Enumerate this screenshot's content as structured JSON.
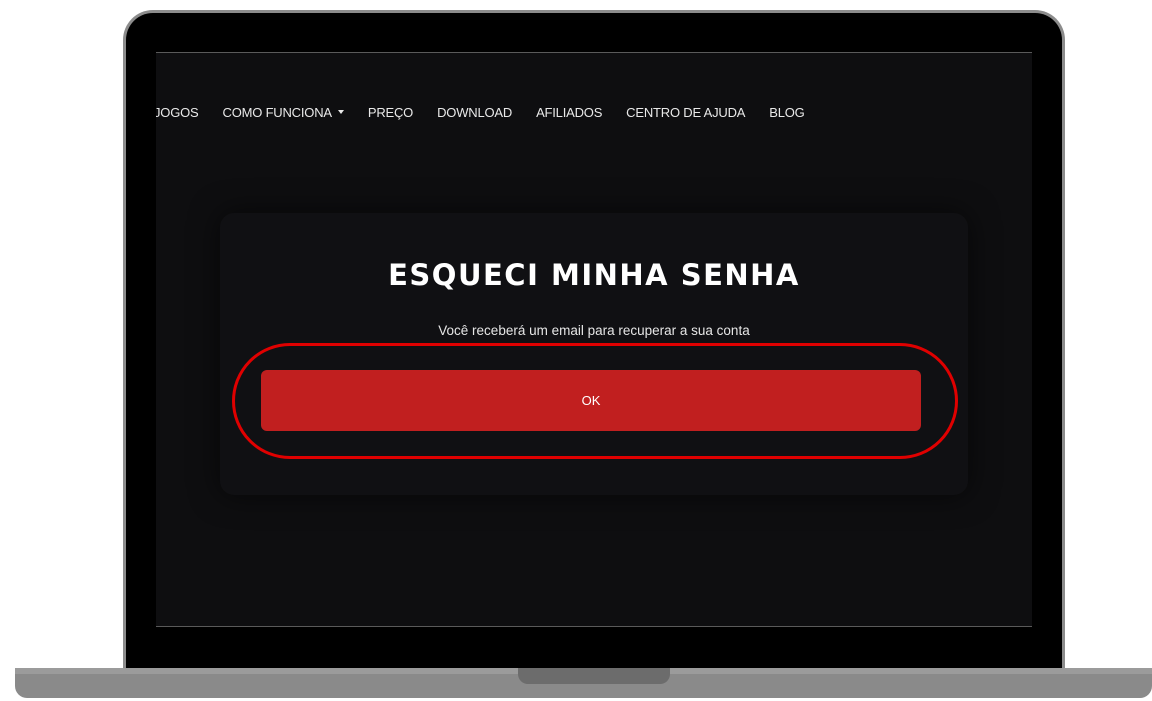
{
  "nav": {
    "items": [
      {
        "label": "JOGOS"
      },
      {
        "label": "COMO FUNCIONA",
        "has_dropdown": true
      },
      {
        "label": "PREÇO"
      },
      {
        "label": "DOWNLOAD"
      },
      {
        "label": "AFILIADOS"
      },
      {
        "label": "CENTRO DE AJUDA"
      },
      {
        "label": "BLOG"
      }
    ]
  },
  "dialog": {
    "title": "ESQUECI MINHA SENHA",
    "subtitle": "Você receberá um email para recuperar a sua conta",
    "ok_label": "OK"
  },
  "colors": {
    "background": "#0e0e10",
    "button": "#c11f1f",
    "highlight": "#e00000",
    "text": "#ffffff"
  }
}
